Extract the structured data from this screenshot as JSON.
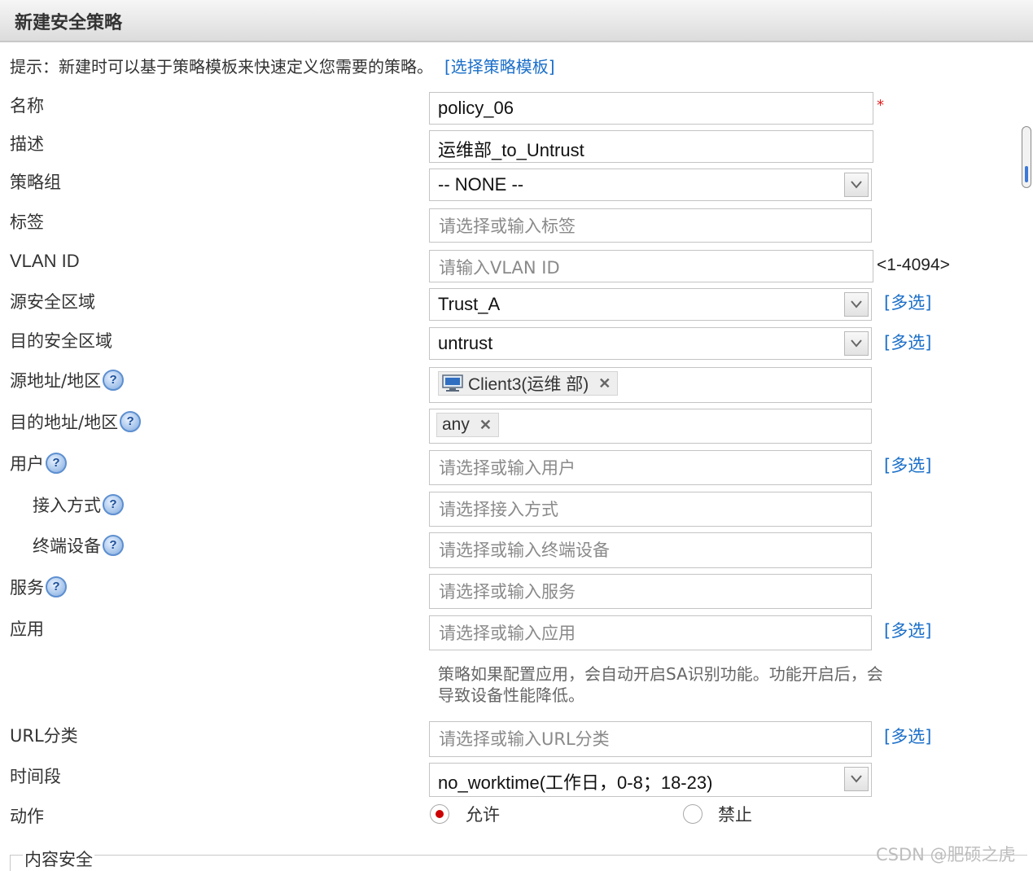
{
  "dialog": {
    "title": "新建安全策略"
  },
  "hint": {
    "text": "提示：新建时可以基于策略模板来快速定义您需要的策略。",
    "link": "[选择策略模板]"
  },
  "fields": {
    "name": {
      "label": "名称",
      "value": "policy_06",
      "required_mark": "*"
    },
    "description": {
      "label": "描述",
      "value": "运维部_to_Untrust"
    },
    "policy_group": {
      "label": "策略组",
      "value": "-- NONE --"
    },
    "tag": {
      "label": "标签",
      "placeholder": "请选择或输入标签"
    },
    "vlan_id": {
      "label": "VLAN ID",
      "placeholder": "请输入VLAN ID",
      "range": "<1-4094>"
    },
    "source_zone": {
      "label": "源安全区域",
      "value": "Trust_A",
      "multi": "[多选]"
    },
    "dest_zone": {
      "label": "目的安全区域",
      "value": "untrust",
      "multi": "[多选]"
    },
    "source_address": {
      "label": "源地址/地区",
      "tag": "Client3(运维 部)"
    },
    "dest_address": {
      "label": "目的地址/地区",
      "tag": "any"
    },
    "user": {
      "label": "用户",
      "placeholder": "请选择或输入用户",
      "multi": "[多选]"
    },
    "access_mode": {
      "label": "接入方式",
      "placeholder": "请选择接入方式"
    },
    "terminal_device": {
      "label": "终端设备",
      "placeholder": "请选择或输入终端设备"
    },
    "service": {
      "label": "服务",
      "placeholder": "请选择或输入服务"
    },
    "application": {
      "label": "应用",
      "placeholder": "请选择或输入应用",
      "multi": "[多选]",
      "note": "策略如果配置应用，会自动开启SA识别功能。功能开启后，会导致设备性能降低。"
    },
    "url_category": {
      "label": "URL分类",
      "placeholder": "请选择或输入URL分类",
      "multi": "[多选]"
    },
    "time_range": {
      "label": "时间段",
      "value": "no_worktime(工作日，0-8；18-23)"
    },
    "action": {
      "label": "动作",
      "options": [
        "允许",
        "禁止"
      ],
      "selected": "允许"
    }
  },
  "content_security": {
    "legend": "内容安全"
  },
  "watermark": "CSDN @肥硕之虎",
  "icons": {
    "help": "help-icon",
    "dropdown": "chevron-down-icon",
    "remove": "close-icon",
    "computer": "computer-icon"
  },
  "colors": {
    "link": "#1a6fc9",
    "required": "#e0201e",
    "radio_selected": "#cc0000"
  }
}
